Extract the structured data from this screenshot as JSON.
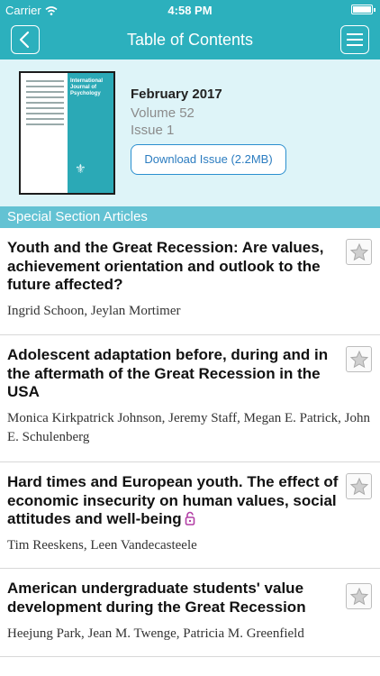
{
  "status_bar": {
    "carrier": "Carrier",
    "time": "4:58 PM"
  },
  "nav": {
    "title": "Table of Contents",
    "back_icon": "chevron-left-icon",
    "menu_icon": "hamburger-menu-icon"
  },
  "issue": {
    "date": "February 2017",
    "volume": "Volume 52",
    "number": "Issue 1",
    "download_label": "Download Issue (2.2MB)",
    "cover_title": "International Journal of Psychology"
  },
  "section": {
    "title": "Special Section Articles"
  },
  "articles": [
    {
      "title": "Youth and the Great Recession: Are values, achievement orientation and outlook to the future affected?",
      "authors": "Ingrid Schoon, Jeylan Mortimer",
      "open_access": false
    },
    {
      "title": "Adolescent adaptation before, during and in the aftermath of the Great Recession in the USA",
      "authors": "Monica Kirkpatrick Johnson, Jeremy Staff, Megan E. Patrick, John E. Schulenberg",
      "open_access": false
    },
    {
      "title": "Hard times and European youth. The effect of economic insecurity on human values, social attitudes and well-being",
      "authors": "Tim Reeskens, Leen Vandecasteele",
      "open_access": true
    },
    {
      "title": "American undergraduate students' value development during the Great Recession",
      "authors": "Heejung Park, Jean M. Twenge, Patricia M. Greenfield",
      "open_access": false
    }
  ],
  "colors": {
    "bar": "#2cb0bd",
    "header_bg": "#def4f8",
    "section_bg": "#63c2d3",
    "download_border": "#2b8fcf",
    "open_access_lock": "#b23fa5"
  }
}
